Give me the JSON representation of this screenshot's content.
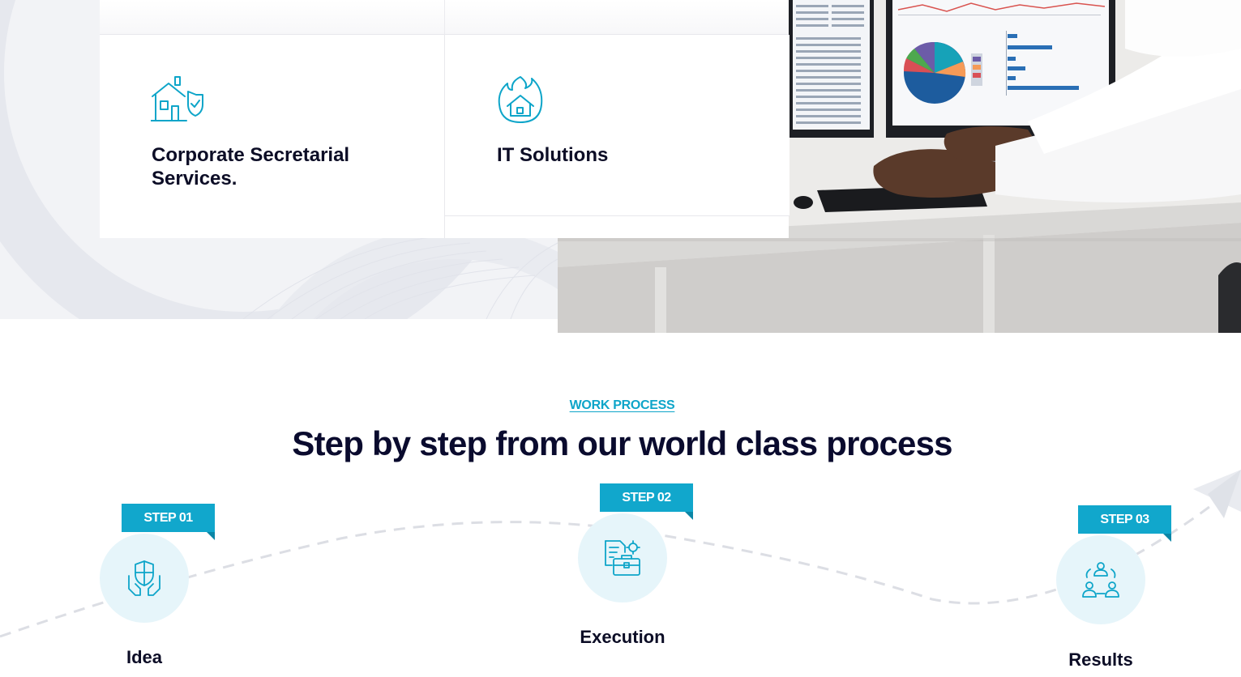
{
  "services": {
    "cards": [
      {
        "title": "Corporate Secretarial Services.",
        "icon": "house-shield-icon"
      },
      {
        "title": "IT Solutions",
        "icon": "house-fire-icon"
      }
    ]
  },
  "process": {
    "eyebrow": "WORK PROCESS",
    "heading": "Step by step from our world class process",
    "steps": [
      {
        "tag": "STEP 01",
        "label": "Idea",
        "icon": "shield-hands-icon"
      },
      {
        "tag": "STEP 02",
        "label": "Execution",
        "icon": "briefcase-documents-icon"
      },
      {
        "tag": "STEP 03",
        "label": "Results",
        "icon": "team-icon"
      }
    ]
  },
  "colors": {
    "accent": "#11a7cc",
    "heading": "#0a0b2e",
    "circle_bg": "#e6f5fa"
  }
}
